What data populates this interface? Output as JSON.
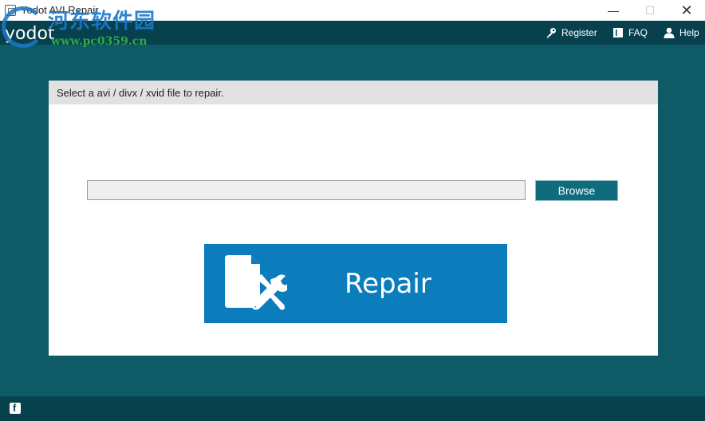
{
  "window": {
    "title": "Yodot AVI Repair",
    "minimize": "—",
    "maximize": "☐",
    "close": "✕"
  },
  "watermark": {
    "text": "河东软件园",
    "url": "www.pc0359.cn"
  },
  "header": {
    "logo": "yodot",
    "nav": [
      {
        "label": "Register",
        "icon": "key-icon"
      },
      {
        "label": "FAQ",
        "icon": "book-icon"
      },
      {
        "label": "Help",
        "icon": "user-icon"
      }
    ]
  },
  "panel": {
    "instruction": "Select a avi / divx / xvid file to repair.",
    "path_value": "",
    "browse_label": "Browse",
    "repair_label": "Repair"
  },
  "footer": {
    "social_icon": "facebook-icon"
  },
  "colors": {
    "background": "#0e5a66",
    "header": "#06414d",
    "browse": "#0e6c7c",
    "repair": "#0b7dbd"
  }
}
